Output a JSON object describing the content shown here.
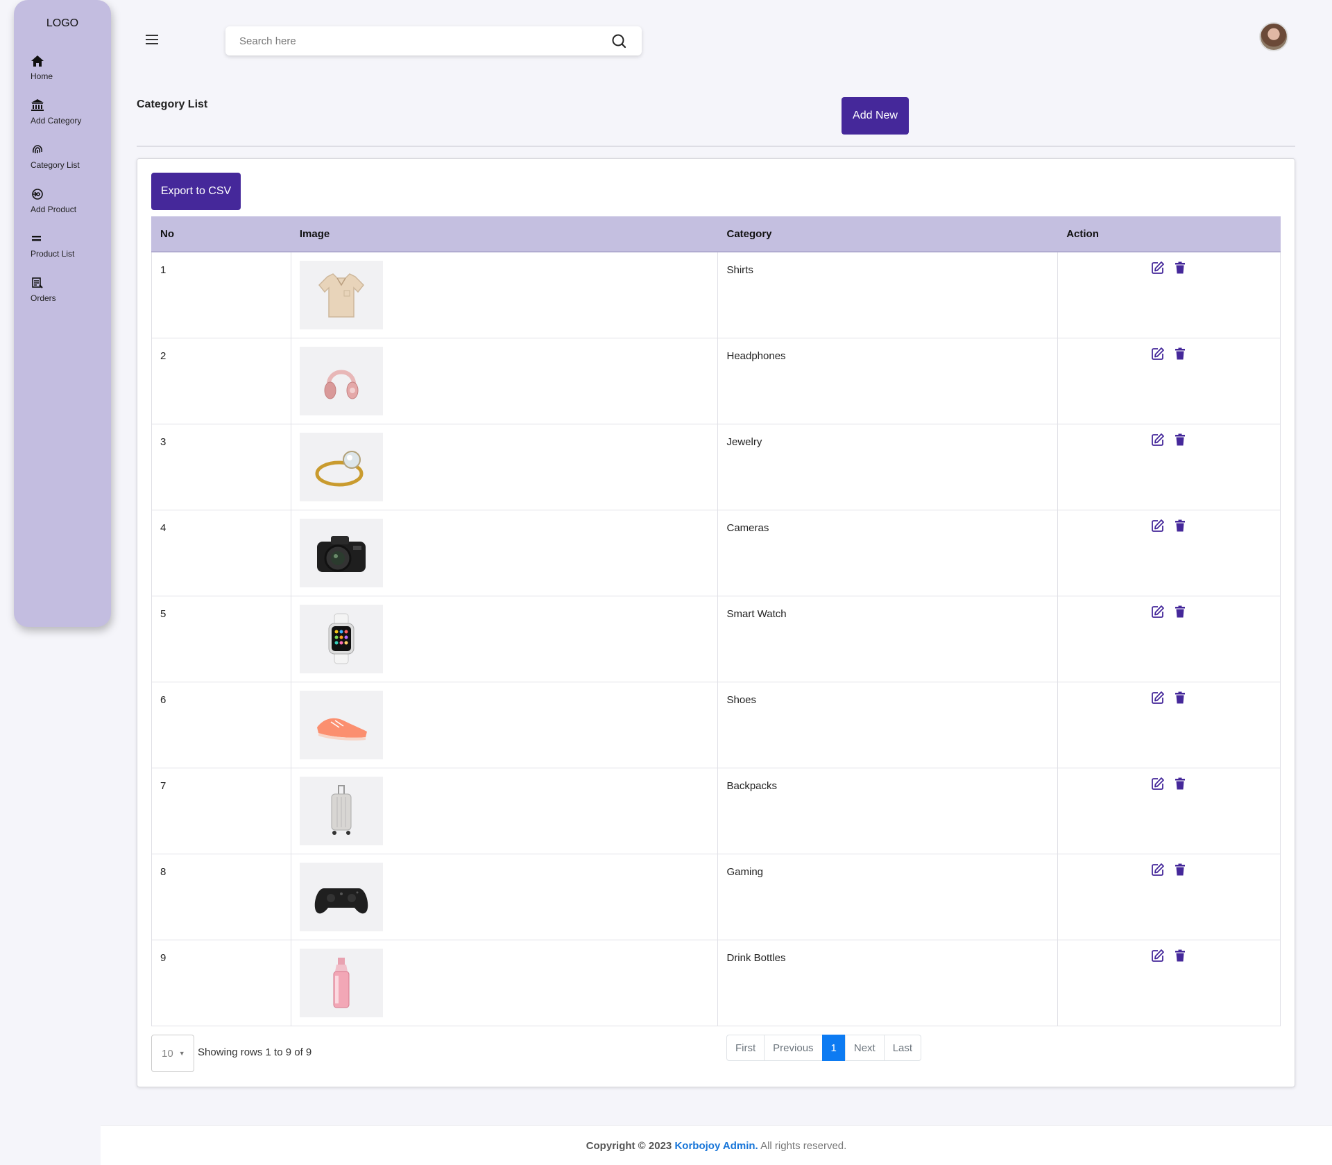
{
  "sidebar": {
    "logo": "LOGO",
    "items": [
      {
        "label": "Home",
        "icon": "home-icon"
      },
      {
        "label": "Add Category",
        "icon": "bank-icon"
      },
      {
        "label": "Category List",
        "icon": "fingerprint-icon"
      },
      {
        "label": "Add Product",
        "icon": "spiral-icon"
      },
      {
        "label": "Product List",
        "icon": "equals-icon"
      },
      {
        "label": "Orders",
        "icon": "list-doc-icon"
      }
    ]
  },
  "topbar": {
    "search_placeholder": "Search here"
  },
  "page": {
    "title": "Category List",
    "add_new_label": "Add New",
    "export_label": "Export to CSV"
  },
  "table": {
    "columns": [
      "No",
      "Image",
      "Category",
      "Action"
    ],
    "rows": [
      {
        "no": "1",
        "category": "Shirts",
        "image": "shirt"
      },
      {
        "no": "2",
        "category": "Headphones",
        "image": "headphones"
      },
      {
        "no": "3",
        "category": "Jewelry",
        "image": "ring"
      },
      {
        "no": "4",
        "category": "Cameras",
        "image": "camera"
      },
      {
        "no": "5",
        "category": "Smart Watch",
        "image": "watch"
      },
      {
        "no": "6",
        "category": "Shoes",
        "image": "shoe"
      },
      {
        "no": "7",
        "category": "Backpacks",
        "image": "luggage"
      },
      {
        "no": "8",
        "category": "Gaming",
        "image": "gamepad"
      },
      {
        "no": "9",
        "category": "Drink Bottles",
        "image": "bottle"
      }
    ]
  },
  "pagination": {
    "page_size": "10",
    "showing": "Showing rows 1 to 9 of 9",
    "first": "First",
    "previous": "Previous",
    "current": "1",
    "next": "Next",
    "last": "Last"
  },
  "footer": {
    "copyright": "Copyright © 2023",
    "brand": "Korbojoy Admin.",
    "rights": "All rights reserved."
  },
  "colors": {
    "sidebar_bg": "#c3bde0",
    "primary": "#45289a",
    "table_header": "#c4bfe0",
    "page_active": "#0d7bf2",
    "brand_link": "#1775d8"
  }
}
